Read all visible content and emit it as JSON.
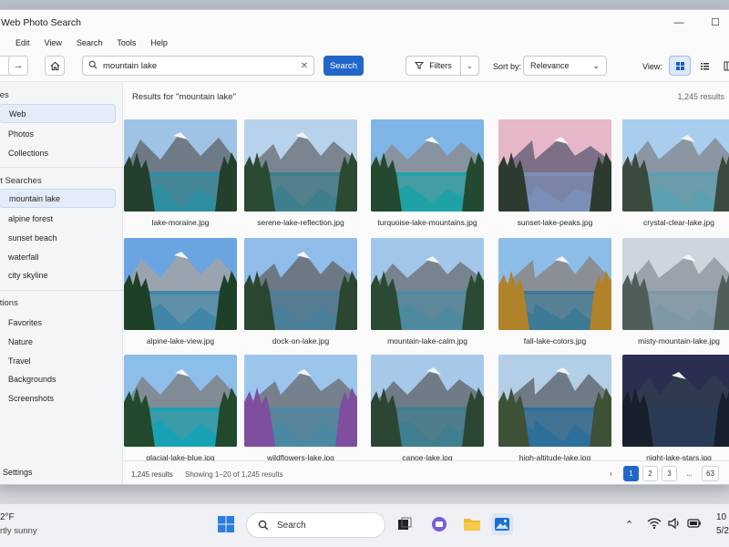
{
  "window": {
    "title": "Web Photo Search",
    "minimize": "—",
    "maximize": "☐"
  },
  "menu": [
    "Edit",
    "View",
    "Search",
    "Tools",
    "Help"
  ],
  "toolbar": {
    "search_value": "mountain lake",
    "search_button": "Search",
    "filters_label": "Filters",
    "sort_label": "Sort by:",
    "sort_value": "Relevance",
    "view_label": "View:"
  },
  "sidebar": {
    "sources_head": "ces",
    "sources": [
      "Web",
      "Photos",
      "Collections"
    ],
    "recent_head": "nt Searches",
    "recent": [
      "mountain lake",
      "alpine forest",
      "sunset beach",
      "waterfall",
      "city skyline"
    ],
    "collections_head": "ctions",
    "collections": [
      "Favorites",
      "Nature",
      "Travel",
      "Backgrounds",
      "Screenshots"
    ],
    "settings": "Settings"
  },
  "results": {
    "title": "Results for \"mountain lake\"",
    "count": "1,245 results",
    "items": [
      {
        "file": "lake-moraine.jpg",
        "sky": "#9fc3e6",
        "mtn": "#6e7a86",
        "water": "#2f8fa0",
        "tree": "#24402c"
      },
      {
        "file": "serene-lake-reflection.jpg",
        "sky": "#b7d3ec",
        "mtn": "#7a8590",
        "water": "#3d7f8c",
        "tree": "#2a4a32"
      },
      {
        "file": "turquoise-lake-mountains.jpg",
        "sky": "#7fb4e6",
        "mtn": "#8893a0",
        "water": "#1fa2a6",
        "tree": "#234a30"
      },
      {
        "file": "sunset-lake-peaks.jpg",
        "sky": "#e6b7c8",
        "mtn": "#7c6f86",
        "water": "#7a8fb8",
        "tree": "#2d3a30"
      },
      {
        "file": "crystal-clear-lake.jpg",
        "sky": "#a8cdee",
        "mtn": "#8a96a2",
        "water": "#5aa0b0",
        "tree": "#3a4a3e"
      },
      {
        "file": "alpine-lake-view.jpg",
        "sky": "#6aa5e2",
        "mtn": "#9aa4ae",
        "water": "#3f86a8",
        "tree": "#1f4028"
      },
      {
        "file": "dock-on-lake.jpg",
        "sky": "#8fbce8",
        "mtn": "#6c7884",
        "water": "#4a7f9a",
        "tree": "#2b4631"
      },
      {
        "file": "mountain-lake-calm.jpg",
        "sky": "#a2c6ea",
        "mtn": "#77838f",
        "water": "#4d8aa0",
        "tree": "#2a4a34"
      },
      {
        "file": "fall-lake-colors.jpg",
        "sky": "#8cbde8",
        "mtn": "#8a8f96",
        "water": "#3c7a96",
        "tree": "#b0832a"
      },
      {
        "file": "misty-mountain-lake.jpg",
        "sky": "#cdd6de",
        "mtn": "#9aa3ab",
        "water": "#7f98a6",
        "tree": "#4f5e58"
      },
      {
        "file": "glacial-lake-blue.jpg",
        "sky": "#8dbde9",
        "mtn": "#808b96",
        "water": "#17a3b4",
        "tree": "#214a2c"
      },
      {
        "file": "wildflowers-lake.jpg",
        "sky": "#9cc5ec",
        "mtn": "#75818d",
        "water": "#4b88a2",
        "tree": "#7e4f9e"
      },
      {
        "file": "canoe-lake.jpg",
        "sky": "#a6c9ea",
        "mtn": "#6f7b86",
        "water": "#3f7f8f",
        "tree": "#2b4733"
      },
      {
        "file": "high-altitude-lake.jpg",
        "sky": "#b3cfe8",
        "mtn": "#6e7b86",
        "water": "#2d6f9a",
        "tree": "#3d5236"
      },
      {
        "file": "night-lake-stars.jpg",
        "sky": "#2a2f52",
        "mtn": "#2f3a4e",
        "water": "#2a3b58",
        "tree": "#17202c"
      }
    ]
  },
  "status": {
    "count": "1,245 results",
    "showing": "Showing 1–20 of 1,245 results",
    "pages": [
      "1",
      "2",
      "3",
      "...",
      "63"
    ]
  },
  "taskbar": {
    "temp": "2°F",
    "weather": "rtly sunny",
    "search": "Search",
    "time": "10",
    "date": "5/2"
  }
}
